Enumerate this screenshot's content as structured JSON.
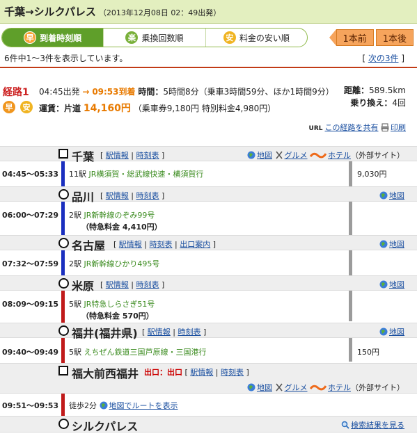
{
  "header": {
    "title": "千葉→シルクパレス",
    "subtitle": "（2013年12月08日 02：49出発）"
  },
  "tabs": [
    {
      "badge": "早",
      "label": "到着時刻順",
      "active": true
    },
    {
      "badge": "楽",
      "label": "乗換回数順",
      "active": false
    },
    {
      "badge": "安",
      "label": "料金の安い順",
      "active": false
    }
  ],
  "nav": {
    "prev": "1本前",
    "next": "1本後"
  },
  "results": {
    "count_text": "6件中1～3件を表示しています。",
    "next_open": "[",
    "next_link": "次の3件",
    "next_close": "]"
  },
  "summary": {
    "route_label": "経路1",
    "dep": "04:45出発",
    "arrow": "→",
    "arr": "09:53到着",
    "time_label": "時間：",
    "time_val": "5時間8分（乗車3時間59分、ほか1時間9分）",
    "fare_label": "運賃：片道",
    "fare": "14,160円",
    "fare_detail": "（乗車券9,180円 特別料金4,980円）",
    "distance_label": "距離：",
    "distance": "589.5km",
    "transfers_label": "乗り換え：",
    "transfers": "4回",
    "badge1": "早",
    "badge2": "安",
    "url_badge": "URL",
    "share": "この経路を共有",
    "print": "印刷"
  },
  "links": {
    "stinfo": "駅情報",
    "timetable": "時刻表",
    "exitinfo": "出口案内",
    "map": "地図",
    "gourmet": "グルメ",
    "hotel": "ホテル",
    "external": "（外部サイト）",
    "sep": "|",
    "lb": "[",
    "rb": "]",
    "map_route": "地図でルートを表示",
    "search_result": "検索結果を見る"
  },
  "stations": [
    {
      "name": "千葉",
      "shape": "square"
    },
    {
      "name": "品川",
      "shape": "circle"
    },
    {
      "name": "名古屋",
      "shape": "circle"
    },
    {
      "name": "米原",
      "shape": "circle"
    },
    {
      "name": "福井(福井県)",
      "shape": "circle"
    },
    {
      "name": "福大前西福井",
      "shape": "square",
      "exit": "出口：出口"
    },
    {
      "name": "シルクパレス",
      "shape": "circle"
    }
  ],
  "segments": [
    {
      "time": "04:45～05:33",
      "stops": "11駅",
      "line": "JR横須賀・総武線快速・横須賀行",
      "color": "#1a2fbf",
      "fare": "9,030円"
    },
    {
      "time": "06:00～07:29",
      "stops": "2駅",
      "line": "JR新幹線のぞみ99号",
      "extra": "（特急料金 4,410円）",
      "color": "#1a2fbf"
    },
    {
      "time": "07:32～07:59",
      "stops": "2駅",
      "line": "JR新幹線ひかり495号",
      "color": "#1a2fbf"
    },
    {
      "time": "08:09～09:15",
      "stops": "5駅",
      "line": "JR特急しらさぎ51号",
      "extra": "（特急料金 570円）",
      "color": "#c01a1a"
    },
    {
      "time": "09:40～09:49",
      "stops": "5駅",
      "line": "えちぜん鉄道三国芦原線・三国港行",
      "color": "#c01a1a",
      "fare": "150円"
    },
    {
      "time": "09:51～09:53",
      "stops": "徒歩2分",
      "color": "#c01a1a"
    }
  ]
}
